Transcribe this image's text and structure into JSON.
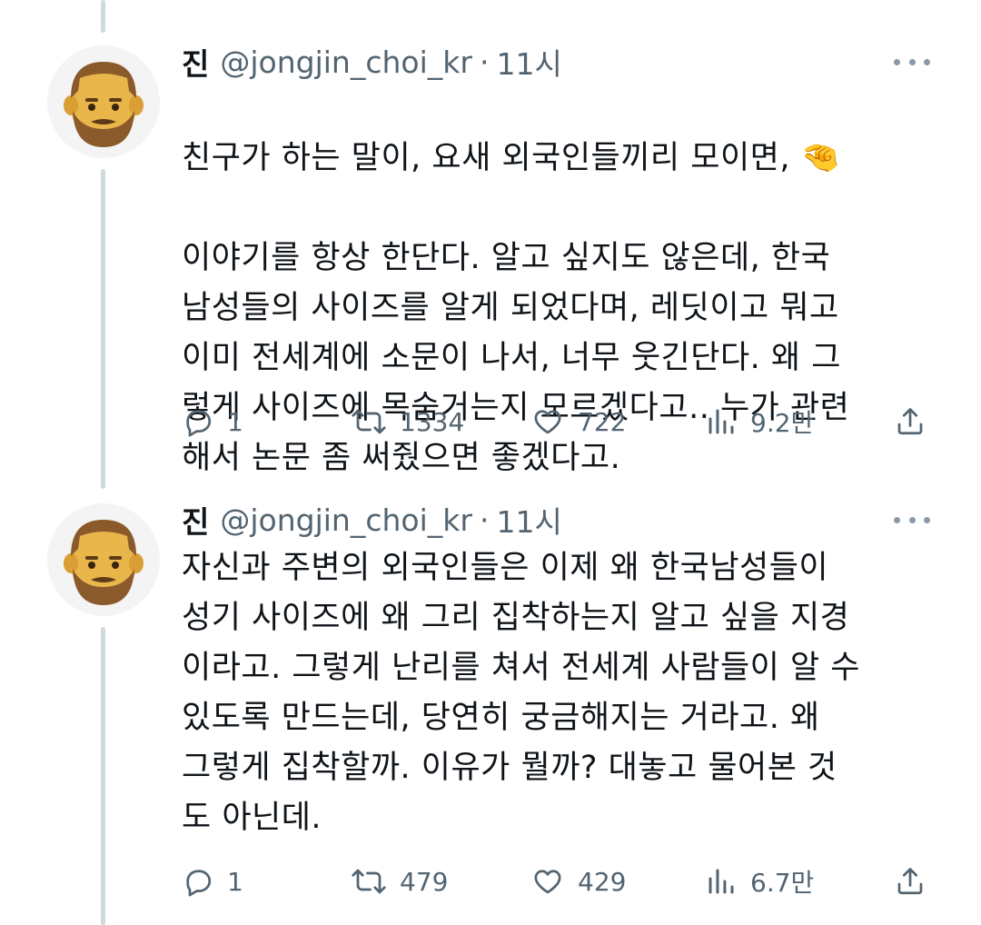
{
  "tweets": [
    {
      "name": "진",
      "handle": "@jongjin_choi_kr",
      "separator": "·",
      "time": "11시",
      "text_line1": "친구가 하는 말이, 요새 외국인들끼리 모이면, 🤏",
      "text_rest": "이야기를 항상 한단다. 알고 싶지도 않은데, 한국\n남성들의 사이즈를 알게 되었다며, 레딧이고 뭐고\n이미 전세계에 소문이 나서, 너무 웃긴단다. 왜 그\n렇게 사이즈에 목숨거는지 모르겠다고.. 누가 관련\n해서 논문 좀 써줬으면 좋겠다고.",
      "replies": "1",
      "retweets": "1334",
      "likes": "722",
      "views": "9.2만"
    },
    {
      "name": "진",
      "handle": "@jongjin_choi_kr",
      "separator": "·",
      "time": "11시",
      "text": "자신과 주변의 외국인들은 이제 왜 한국남성들이\n성기 사이즈에 왜 그리 집착하는지 알고 싶을 지경\n이라고. 그렇게 난리를 쳐서 전세계 사람들이 알 수\n있도록 만드는데, 당연히 궁금해지는 거라고. 왜\n그렇게 집착할까. 이유가 뭘까? 대놓고 물어본 것\n도 아닌데.",
      "replies": "1",
      "retweets": "479",
      "likes": "429",
      "views": "6.7만"
    }
  ],
  "icons": {
    "avatar": "bearded-man-emoji-avatar",
    "more": "more-dots-icon",
    "reply": "reply-icon",
    "retweet": "retweet-icon",
    "like": "heart-icon",
    "views": "views-bar-icon",
    "share": "share-icon"
  },
  "colors": {
    "text": "#0f1419",
    "secondary": "#536471",
    "thread_line": "#cfd9de"
  }
}
